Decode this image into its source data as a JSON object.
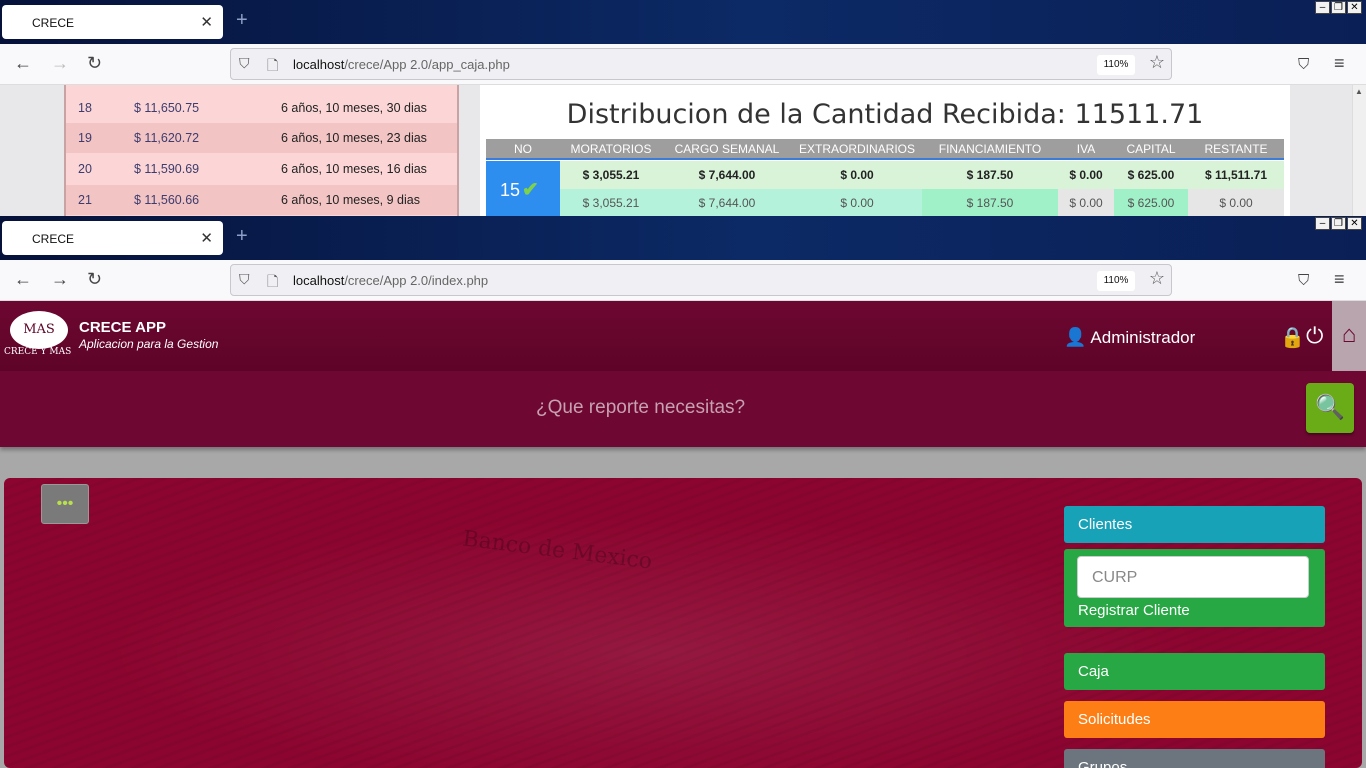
{
  "window1": {
    "tab_title": "CRECE",
    "url_host": "localhost",
    "url_path": "/crece/App 2.0/app_caja.php",
    "zoom": "110%",
    "payments": [
      {
        "no": "18",
        "amount": "$ 11,650.75",
        "time": "6 años, 10 meses, 30 dias"
      },
      {
        "no": "19",
        "amount": "$ 11,620.72",
        "time": "6 años, 10 meses, 23 dias"
      },
      {
        "no": "20",
        "amount": "$ 11,590.69",
        "time": "6 años, 10 meses, 16 dias"
      },
      {
        "no": "21",
        "amount": "$ 11,560.66",
        "time": "6 años, 10 meses, 9 dias"
      }
    ],
    "distribution": {
      "title": "Distribucion de la Cantidad Recibida: 11511.71",
      "headers": [
        "NO",
        "MORATORIOS",
        "CARGO SEMANAL",
        "EXTRAORDINARIOS",
        "FINANCIAMIENTO",
        "IVA",
        "CAPITAL",
        "RESTANTE"
      ],
      "number": "15",
      "row1": [
        "$ 3,055.21",
        "$ 7,644.00",
        "$ 0.00",
        "$ 187.50",
        "$ 0.00",
        "$ 625.00",
        "$ 11,511.71"
      ],
      "row2": [
        "$ 3,055.21",
        "$ 7,644.00",
        "$ 0.00",
        "$ 187.50",
        "$ 0.00",
        "$ 625.00",
        "$ 0.00"
      ]
    }
  },
  "window2": {
    "tab_title": "CRECE",
    "url_host": "localhost",
    "url_path": "/crece/App 2.0/index.php",
    "zoom": "110%",
    "app": {
      "logo_text": "MAS",
      "logo_subtitle": "CRECE Y MAS",
      "title": "CRECE APP",
      "subtitle": "Aplicacion para la Gestion",
      "user": "Administrador"
    },
    "search_placeholder": "¿Que reporte necesitas?",
    "menu": {
      "clientes": "Clientes",
      "curp_placeholder": "CURP",
      "registrar": "Registrar Cliente",
      "caja": "Caja",
      "solicitudes": "Solicitudes",
      "grupos": "Grupos"
    }
  }
}
